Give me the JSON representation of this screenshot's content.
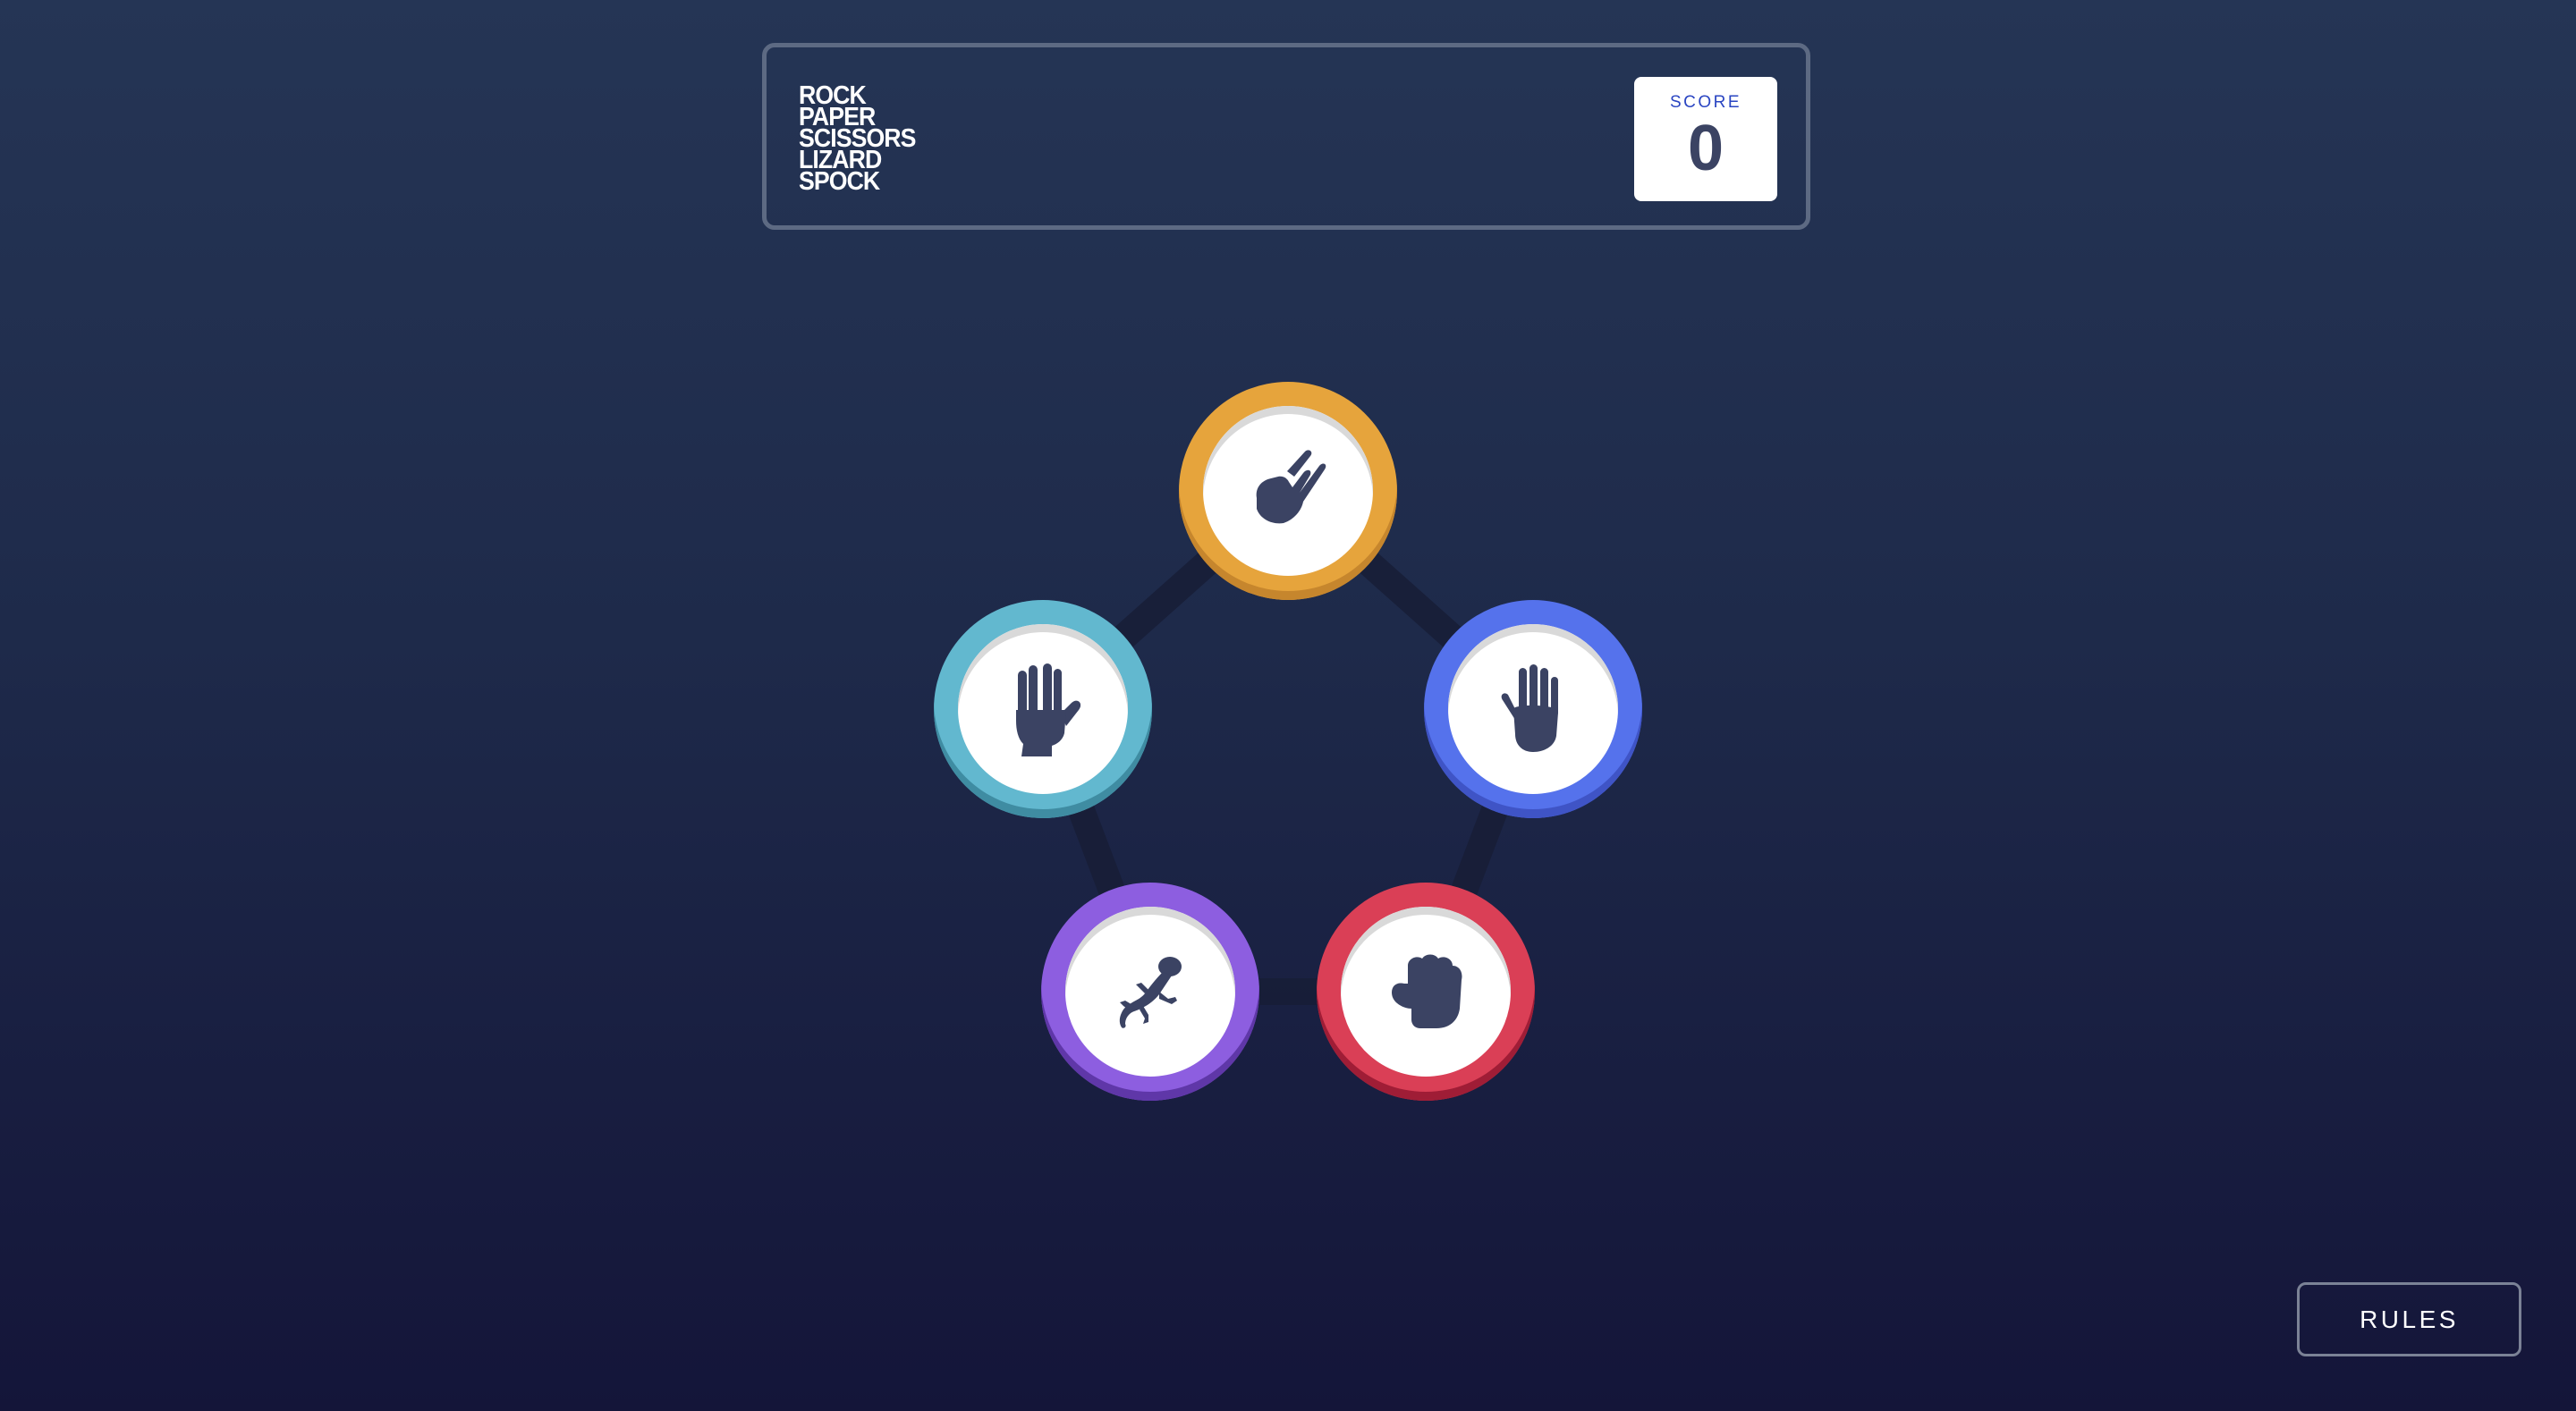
{
  "header": {
    "title_lines": [
      "ROCK",
      "PAPER",
      "SCISSORS",
      "LIZARD",
      "SPOCK"
    ],
    "score_label": "SCORE",
    "score_value": "0"
  },
  "tokens": [
    {
      "id": "scissors",
      "icon": "scissors-hand-icon",
      "color": "#e6a43c"
    },
    {
      "id": "paper",
      "icon": "paper-hand-icon",
      "color": "#5572ec"
    },
    {
      "id": "rock",
      "icon": "rock-fist-icon",
      "color": "#da3f56"
    },
    {
      "id": "lizard",
      "icon": "lizard-icon",
      "color": "#8d5ee0"
    },
    {
      "id": "spock",
      "icon": "spock-hand-icon",
      "color": "#62b8cf"
    }
  ],
  "rules_button": {
    "label": "RULES"
  },
  "colors": {
    "background_top": "#253555",
    "background_bottom": "#141539",
    "icon": "#3b4363"
  }
}
